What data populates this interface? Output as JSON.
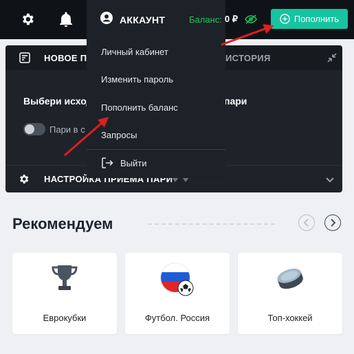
{
  "topbar": {
    "icons": [
      "gear-icon",
      "bell-icon"
    ],
    "account_label": "АККАУНТ",
    "balance_label": "Баланс:",
    "balance_value": "0 ₽",
    "topup_label": "Пополнить",
    "colors": {
      "accent": "#16c4a2",
      "balance": "#21c45a",
      "bg": "#0f1318"
    }
  },
  "dropdown": {
    "items": [
      "Личный кабинет",
      "Изменить пароль",
      "Пополнить баланс",
      "Запросы"
    ],
    "logout_label": "Выйти"
  },
  "panel": {
    "head_left": "НОВОЕ П",
    "head_right": "ИСТОРИЯ",
    "body_left": "Выбери исход",
    "body_right": "пари",
    "toggle_label": "Пари в с",
    "foot_label": "НАСТРОЙКА ПРИЕМА ПАРИ"
  },
  "recommend": {
    "title": "Рекомендуем",
    "cards": [
      {
        "label": "Еврокубки",
        "icon": "trophy-icon"
      },
      {
        "label": "Футбол. Россия",
        "icon": "russia-football-icon"
      },
      {
        "label": "Топ-хоккей",
        "icon": "hockey-puck-icon"
      }
    ]
  },
  "annotations": {
    "arrow_color": "#d92020"
  }
}
